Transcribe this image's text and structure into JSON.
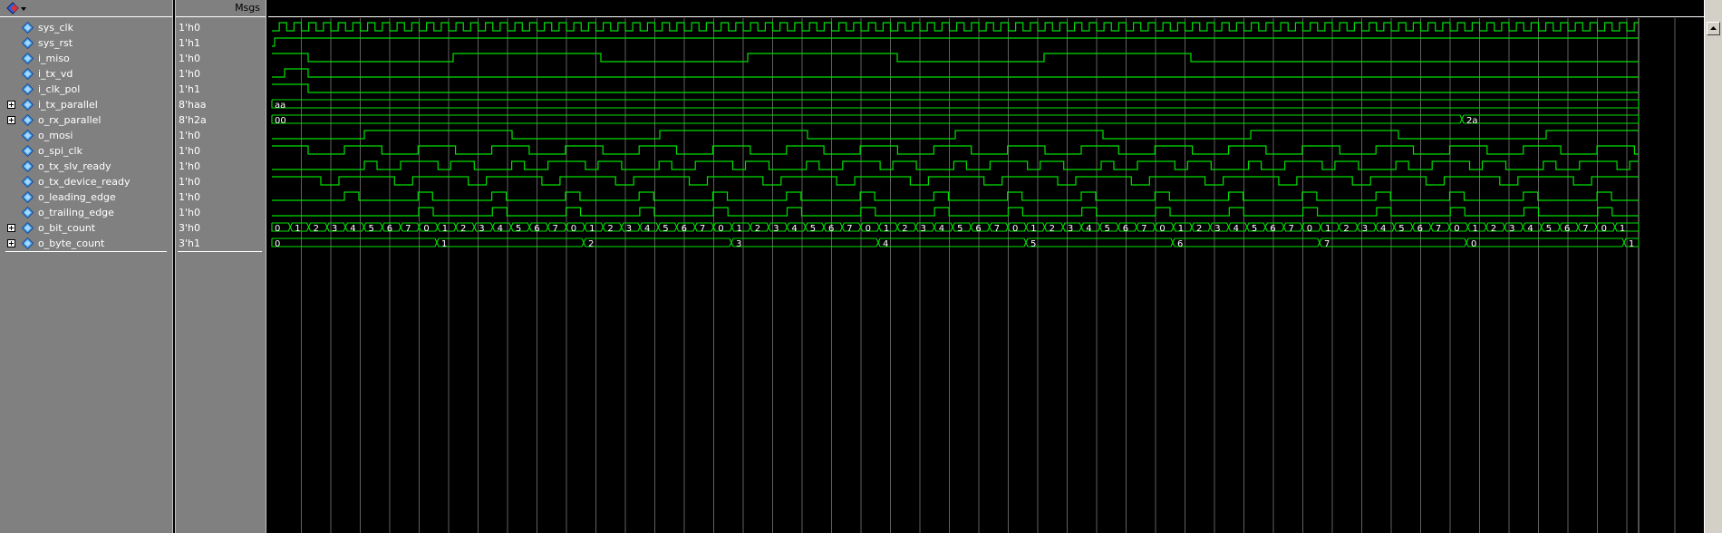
{
  "header": {
    "msgs_label": "Msgs"
  },
  "signals": [
    {
      "name": "sys_clk",
      "value": "1'h0",
      "expandable": false
    },
    {
      "name": "sys_rst",
      "value": "1'h1",
      "expandable": false
    },
    {
      "name": "i_miso",
      "value": "1'h0",
      "expandable": false
    },
    {
      "name": "i_tx_vd",
      "value": "1'h0",
      "expandable": false
    },
    {
      "name": "i_clk_pol",
      "value": "1'h1",
      "expandable": false
    },
    {
      "name": "i_tx_parallel",
      "value": "8'haa",
      "expandable": true
    },
    {
      "name": "o_rx_parallel",
      "value": "8'h2a",
      "expandable": true
    },
    {
      "name": "o_mosi",
      "value": "1'h0",
      "expandable": false
    },
    {
      "name": "o_spi_clk",
      "value": "1'h0",
      "expandable": false
    },
    {
      "name": "o_tx_slv_ready",
      "value": "1'h0",
      "expandable": false
    },
    {
      "name": "o_tx_device_ready",
      "value": "1'h0",
      "expandable": false
    },
    {
      "name": "o_leading_edge",
      "value": "1'h0",
      "expandable": false
    },
    {
      "name": "o_trailing_edge",
      "value": "1'h0",
      "expandable": false
    },
    {
      "name": "o_bit_count",
      "value": "3'h0",
      "expandable": true
    },
    {
      "name": "o_byte_count",
      "value": "3'h1",
      "expandable": true
    }
  ],
  "bus_labels": {
    "i_tx_parallel": [
      "aa"
    ],
    "o_rx_parallel": [
      "00",
      "2a"
    ],
    "o_bit_count": [
      "0",
      "1",
      "2",
      "3",
      "4",
      "5",
      "6",
      "7"
    ],
    "o_byte_count": [
      "0",
      "1",
      "2",
      "3",
      "4",
      "5",
      "6",
      "7",
      "0",
      "1"
    ]
  },
  "colors": {
    "wave": "#00e000",
    "grid": "#606060",
    "background": "#000000"
  }
}
